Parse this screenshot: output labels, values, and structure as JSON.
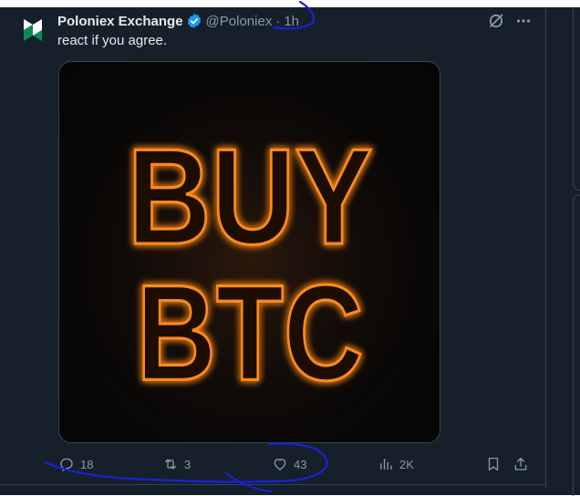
{
  "tweet": {
    "author_name": "Poloniex Exchange",
    "handle": "@Poloniex",
    "separator": "·",
    "time": "1h",
    "text": "react if you agree.",
    "verified": true,
    "avatar_icon": "poloniex-logo-icon",
    "top_actions": [
      {
        "name": "grok-icon"
      },
      {
        "name": "more-icon"
      }
    ],
    "media": {
      "line1": "BUY",
      "line2": "BTC",
      "glow_color": "#ff8a1e"
    },
    "actions": {
      "replies": "18",
      "retweets": "3",
      "likes": "43",
      "views": "2K"
    }
  },
  "colors": {
    "background": "#15202b",
    "text": "#e7e9ea",
    "muted": "#8b98a5",
    "verified": "#1d9bf0",
    "border": "#38444d",
    "annotation": "#1a20d8"
  }
}
